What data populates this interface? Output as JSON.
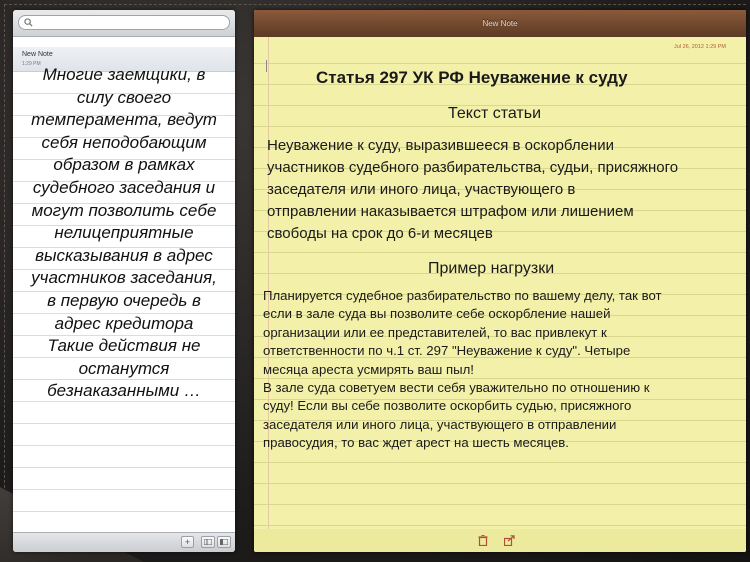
{
  "notes_list": {
    "search_placeholder": "",
    "items": [
      {
        "title": "New Note",
        "time": "1:29 PM"
      }
    ],
    "footer": {
      "add_label": "+"
    }
  },
  "overlay_lines": [
    "Многие заемщики, в",
    "силу своего",
    "темперамента, ведут",
    "себя неподобающим",
    "образом в рамках",
    "судебного заседания и",
    "могут позволить себе",
    "нелицеприятные",
    "высказывания в адрес",
    "участников заседания,",
    "в первую очередь в",
    "адрес кредитора",
    "Такие действия не",
    "останутся",
    "безнаказанными …"
  ],
  "note": {
    "window_title": "New Note",
    "date": "Jul 26, 2012 1:29 PM",
    "heading": "Статья 297 УК РФ Неуважение к суду",
    "section1_title": "Текст статьи",
    "section1_lines": [
      "Неуважение к суду, выразившееся в оскорблении",
      "участников судебного разбирательства, судьи, присяжного",
      "заседателя или иного лица, участвующего в",
      "отправлении наказывается штрафом или лишением",
      "свободы на срок до 6-и месяцев"
    ],
    "section2_title": "Пример нагрузки",
    "section2_lines": [
      "Планируется судебное разбирательство по вашему делу, так вот",
      "если в зале суда вы позволите себе оскорбление нашей",
      "организации или ее представителей, то вас привлекут к",
      "ответственности по ч.1 ст. 297 \"Неуважение к суду\". Четыре",
      "месяца ареста усмирять ваш пыл!",
      "В зале суда советуем вести себя уважительно по отношению к",
      "суду! Если вы себе позволите оскорбить судью, присяжного",
      "заседателя или иного лица, участвующего в отправлении",
      "правосудия, то вас ждет арест на шесть месяцев."
    ]
  },
  "colors": {
    "paper": "#f3f1a9",
    "titlebar": "#6e4630",
    "date": "#b05a38"
  }
}
